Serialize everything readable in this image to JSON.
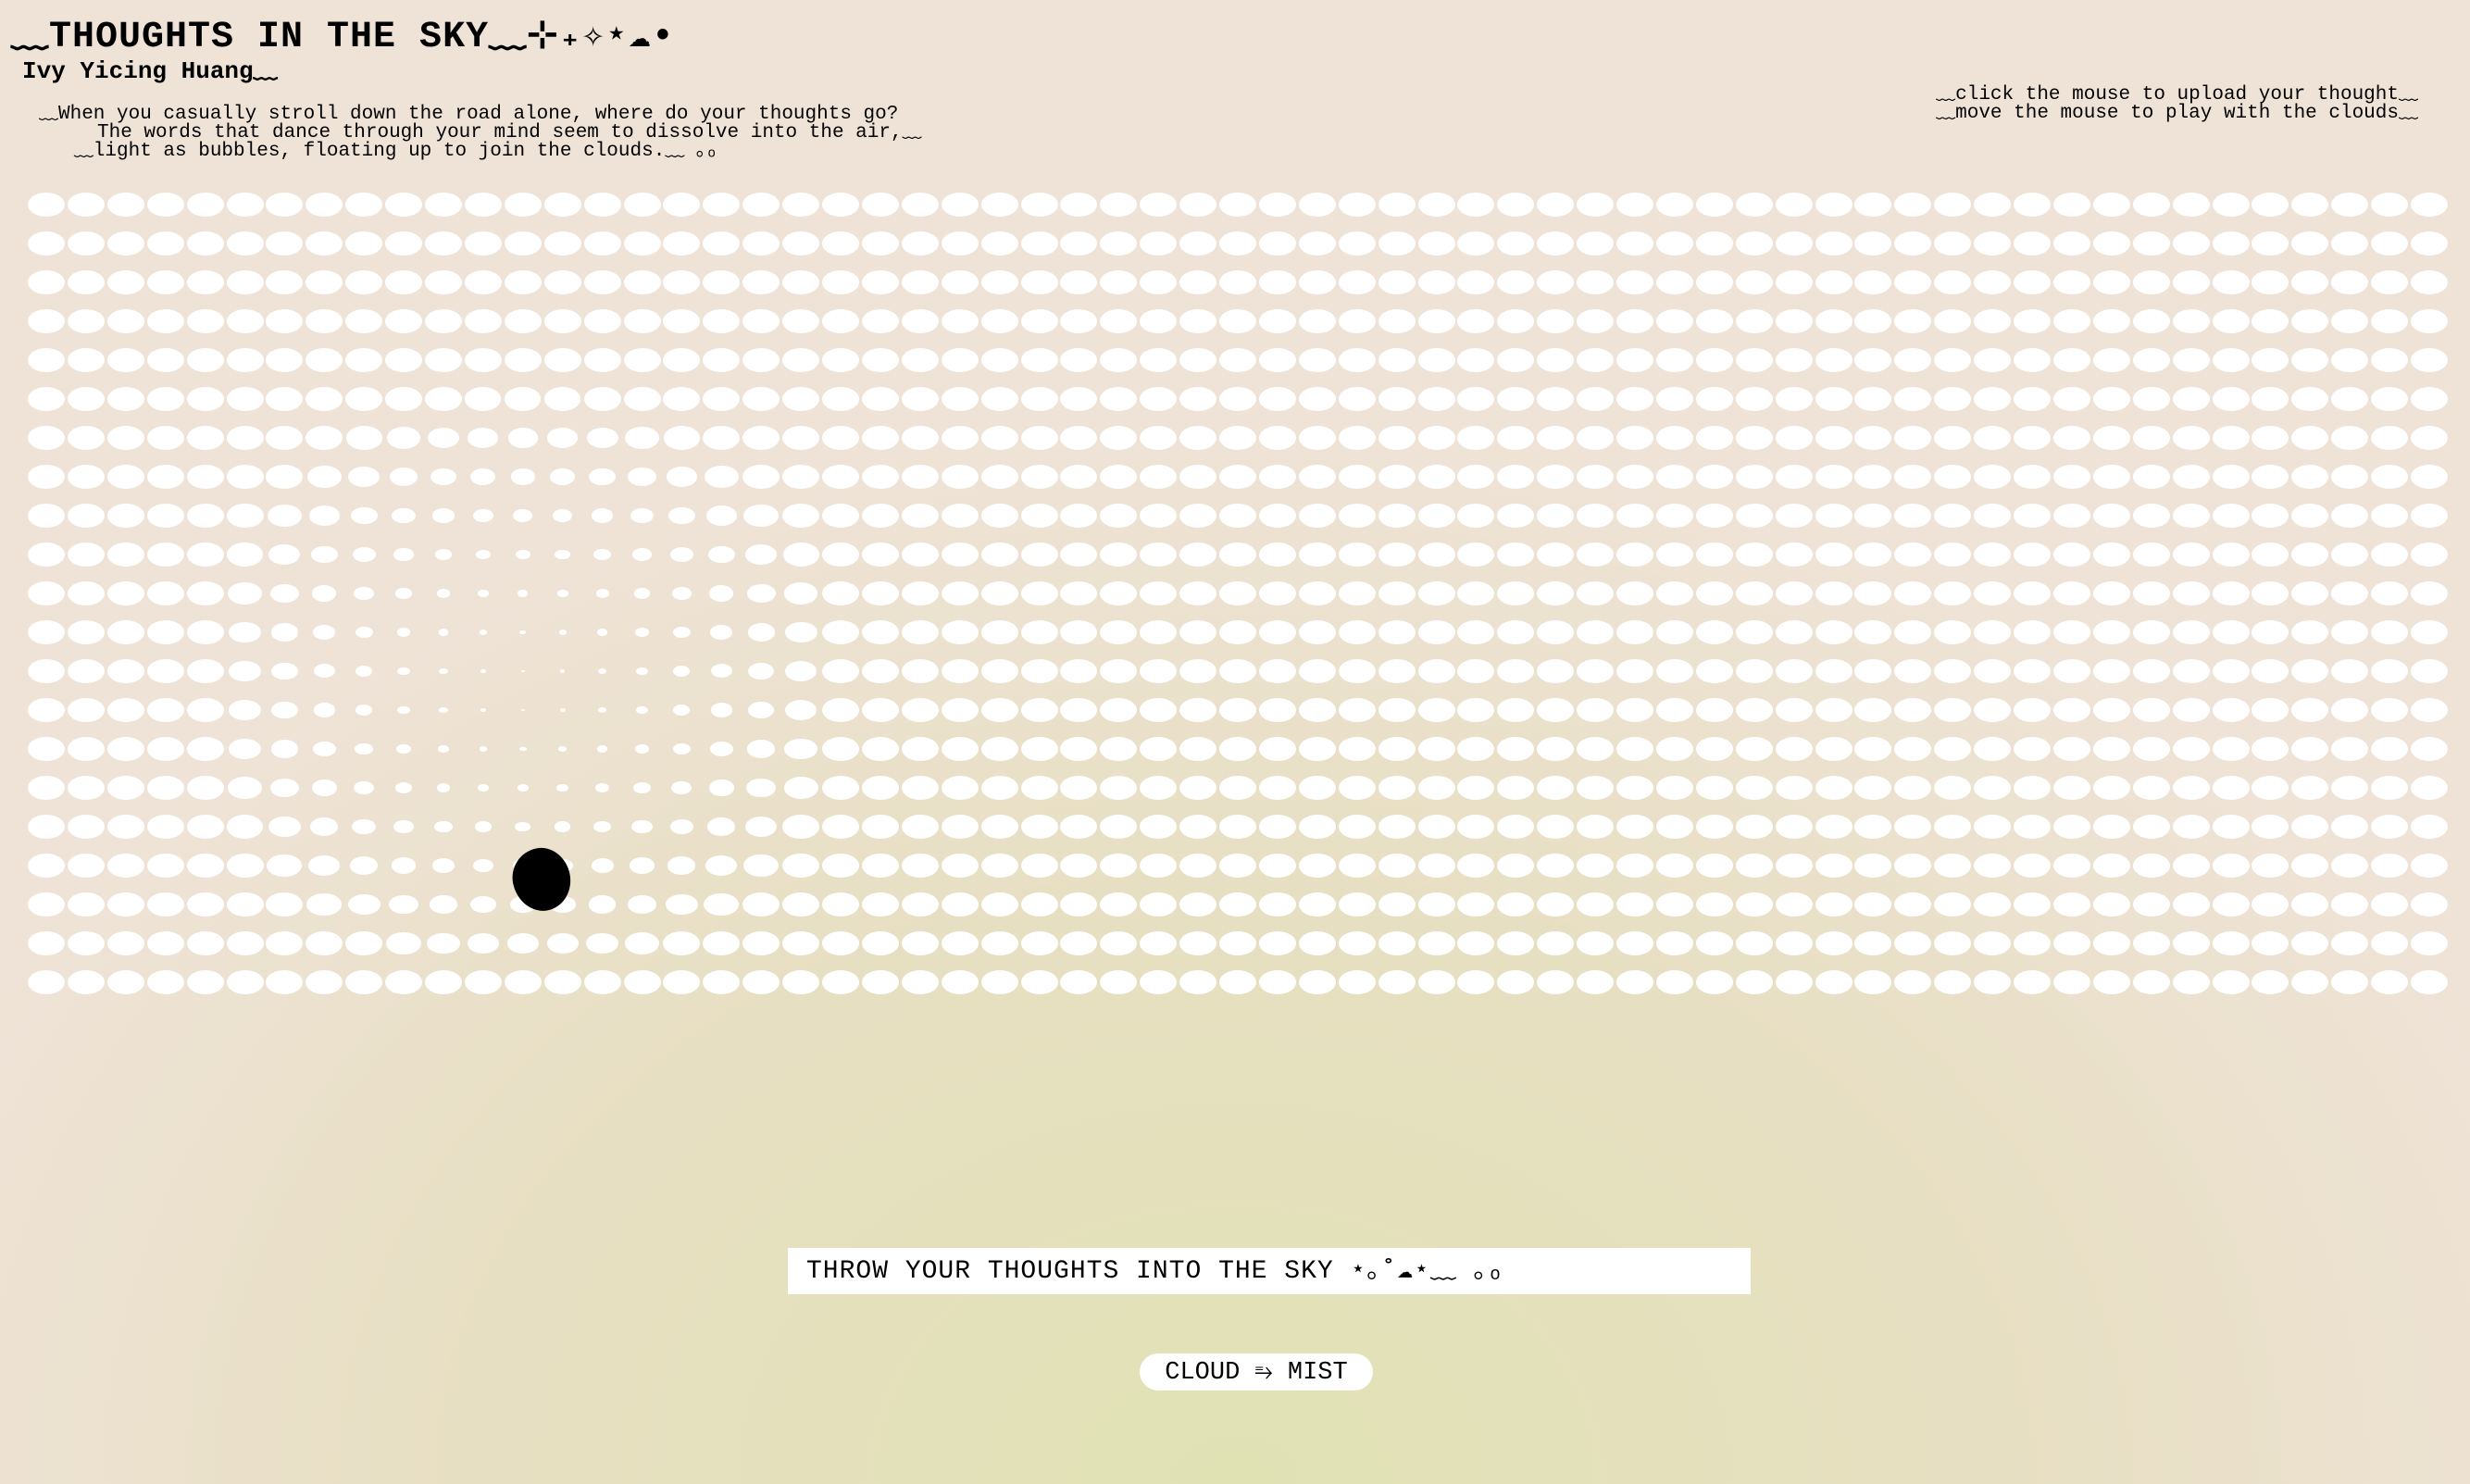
{
  "header": {
    "title": "﹏THOUGHTS IN THE SKY﹏⊹₊✧⋆☁︎•",
    "author": "Ivy Yicing Huang﹏"
  },
  "intro": {
    "lines": [
      "﹏When you casually stroll down the road alone, where do your thoughts go?",
      "The words that dance through your mind seem to dissolve into the air,﹏",
      "﹏light as bubbles, floating up to join the clouds.﹏ ｡ₒ"
    ]
  },
  "instructions": {
    "lines": [
      "﹏click the mouse to upload your thought﹏",
      "﹏move the mouse to play with the clouds﹏"
    ]
  },
  "cloud_field": {
    "rows": 21,
    "columns": 61,
    "cursor_column": 12,
    "cursor_row": 12.4,
    "puff_color": "#ffffff",
    "cursor_color": "#000000"
  },
  "input": {
    "placeholder": "THROW YOUR THOUGHTS INTO THE SKY ⋆｡˚☁︎⋆﹏ ｡ₒ",
    "value": ""
  },
  "toggle": {
    "left_label": "CLOUD",
    "icon": "⥱",
    "right_label": "MIST"
  },
  "colors": {
    "background_top": "#efe3d7",
    "background_bottom": "#e0e2b4",
    "text": "#000000"
  }
}
